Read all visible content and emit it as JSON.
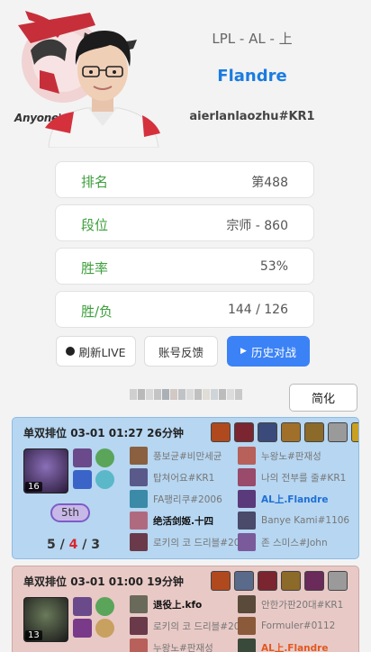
{
  "profile": {
    "league": "LPL - AL - 上",
    "name": "Flandre",
    "tag": "aierlanlaozhu#KR1",
    "team_wordmark": "Anyone's Legend"
  },
  "stats": [
    {
      "label": "排名",
      "value": "第488"
    },
    {
      "label": "段位",
      "value": "宗师 - 860"
    },
    {
      "label": "胜率",
      "value": "53%"
    },
    {
      "label": "胜/负",
      "value": "144 / 126"
    }
  ],
  "actions": {
    "refresh": "刷新LIVE",
    "feedback": "账号反馈",
    "history": "历史对战",
    "simplified": "简化"
  },
  "matches": [
    {
      "queue": "单双排位",
      "date": "03-01 01:27",
      "duration": "26分钟",
      "result_color": "#b6d6f1",
      "level": "16",
      "placement": "5th",
      "kda": {
        "k": "5",
        "d": "4",
        "a": "3"
      },
      "items": [
        "#b04a1e",
        "#7a2530",
        "#3a4a7a",
        "#a0702a",
        "#8c6a2a",
        "#9a9a9a",
        "#c9a020"
      ],
      "team_left": [
        {
          "name": "풍보균#비만세균",
          "style": ""
        },
        {
          "name": "탑쳐어요#KR1",
          "style": ""
        },
        {
          "name": "FA팽리쿠#2006",
          "style": ""
        },
        {
          "name": "绝活剑姬.十四",
          "style": "dark"
        },
        {
          "name": "로키의 코 드리블#20",
          "style": ""
        }
      ],
      "team_right": [
        {
          "name": "누왕노#판재성",
          "style": ""
        },
        {
          "name": "나의 전부를 줄#KR1",
          "style": ""
        },
        {
          "name": "AL上.Flandre",
          "style": "me"
        },
        {
          "name": "Banye Kami#1106",
          "style": ""
        },
        {
          "name": "존 스미스#John",
          "style": ""
        }
      ]
    },
    {
      "queue": "单双排位",
      "date": "03-01 01:00",
      "duration": "19分钟",
      "result_color": "#e8c9c6",
      "level": "13",
      "items": [
        "#b04a1e",
        "#5a6a8a",
        "#7a2530",
        "#8c6a2a",
        "#6a2a5a",
        "#9a9a9a"
      ],
      "team_left": [
        {
          "name": "退役上.kfo",
          "style": "dark"
        },
        {
          "name": "로키의 코 드리블#20",
          "style": ""
        },
        {
          "name": "누왕노#판재성",
          "style": ""
        }
      ],
      "team_right": [
        {
          "name": "안한가판20대#KR1",
          "style": ""
        },
        {
          "name": "Formuler#0112",
          "style": ""
        },
        {
          "name": "AL上.Flandre",
          "style": "me2"
        }
      ]
    }
  ],
  "colors": {
    "accent": "#1a7ce0",
    "stat_label": "#3d9e3d",
    "history_button": "#3b82f6",
    "deaths": "#d9262c"
  }
}
